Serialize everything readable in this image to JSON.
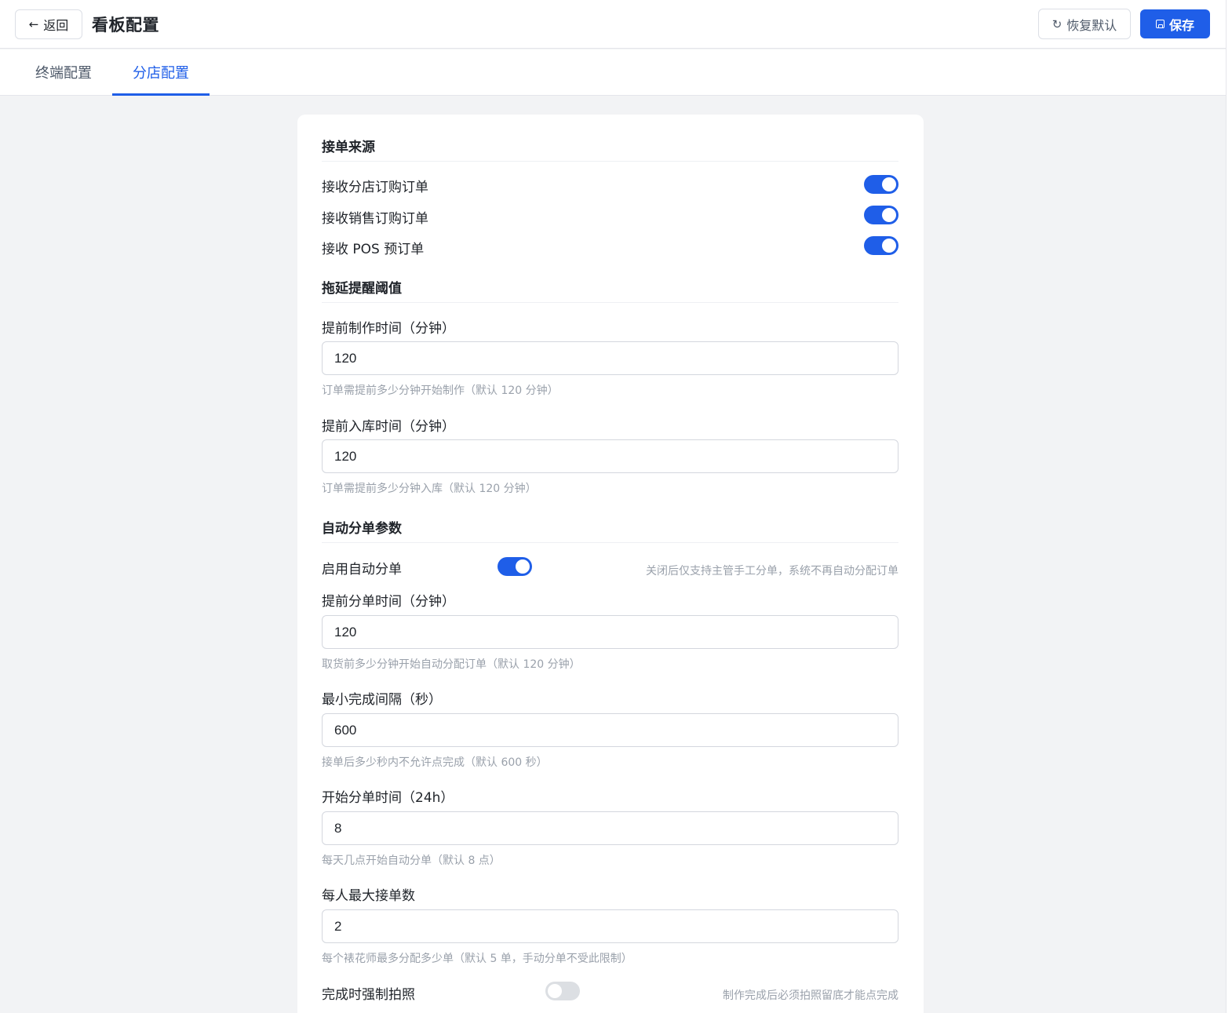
{
  "header": {
    "back_label": "返回",
    "title": "看板配置",
    "reset_label": "恢复默认",
    "save_label": "保存"
  },
  "tabs": [
    {
      "label": "终端配置",
      "active": false
    },
    {
      "label": "分店配置",
      "active": true
    }
  ],
  "colors": {
    "accent": "#1f5ee8",
    "toggle_off": "#dcdfe3"
  },
  "sections": {
    "order_source": {
      "title": "接单来源",
      "items": [
        {
          "label": "接收分店订购订单",
          "enabled": true
        },
        {
          "label": "接收销售订购订单",
          "enabled": true
        },
        {
          "label": "接收 POS 预订单",
          "enabled": true
        }
      ]
    },
    "delay_threshold": {
      "title": "拖延提醒阈值",
      "fields": [
        {
          "label": "提前制作时间（分钟）",
          "value": "120",
          "hint": "订单需提前多少分钟开始制作（默认 120 分钟）"
        },
        {
          "label": "提前入库时间（分钟）",
          "value": "120",
          "hint": "订单需提前多少分钟入库（默认 120 分钟）"
        }
      ]
    },
    "auto_assign": {
      "title": "自动分单参数",
      "enable_label": "启用自动分单",
      "enable_on": true,
      "enable_hint": "关闭后仅支持主管手工分单，系统不再自动分配订单",
      "fields": [
        {
          "label": "提前分单时间（分钟）",
          "value": "120",
          "hint": "取货前多少分钟开始自动分配订单（默认 120 分钟）"
        },
        {
          "label": "最小完成间隔（秒）",
          "value": "600",
          "hint": "接单后多少秒内不允许点完成（默认 600 秒）"
        },
        {
          "label": "开始分单时间（24h）",
          "value": "8",
          "hint": "每天几点开始自动分单（默认 8 点）"
        },
        {
          "label": "每人最大接单数",
          "value": "2",
          "hint": "每个裱花师最多分配多少单（默认 5 单，手动分单不受此限制）"
        }
      ],
      "photo_label": "完成时强制拍照",
      "photo_on": false,
      "photo_hint": "制作完成后必须拍照留底才能点完成"
    }
  }
}
